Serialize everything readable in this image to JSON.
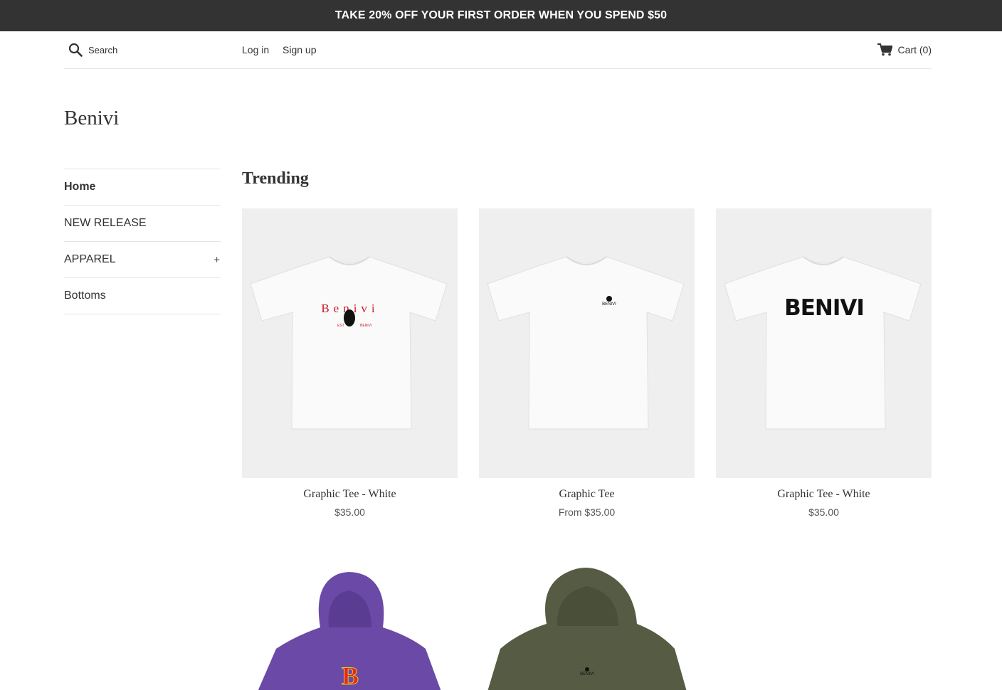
{
  "announcement": "TAKE 20% OFF YOUR FIRST ORDER WHEN YOU SPEND $50",
  "header": {
    "search_placeholder": "Search",
    "login": "Log in",
    "signup": "Sign up",
    "cart": "Cart (0)"
  },
  "brand": "Benivi",
  "sidebar": {
    "items": [
      {
        "label": "Home",
        "active": true
      },
      {
        "label": "NEW RELEASE"
      },
      {
        "label": "APPAREL",
        "expand": "+"
      },
      {
        "label": "Bottoms"
      }
    ]
  },
  "section_title": "Trending",
  "products": [
    {
      "title": "Graphic Tee - White",
      "price": "$35.00",
      "print_text": "Benivi"
    },
    {
      "title": "Graphic Tee",
      "price": "From $35.00",
      "print_text": "BENIVI"
    },
    {
      "title": "Graphic Tee - White",
      "price": "$35.00",
      "print_text": "BENIVI"
    }
  ],
  "hoodies": [
    {
      "color": "#6a4aa6",
      "print_text": "B"
    },
    {
      "color": "#565c43",
      "print_text": "BENIVI"
    }
  ],
  "colors": {
    "announce_bg": "#333333",
    "accent_red": "#c8202a"
  }
}
